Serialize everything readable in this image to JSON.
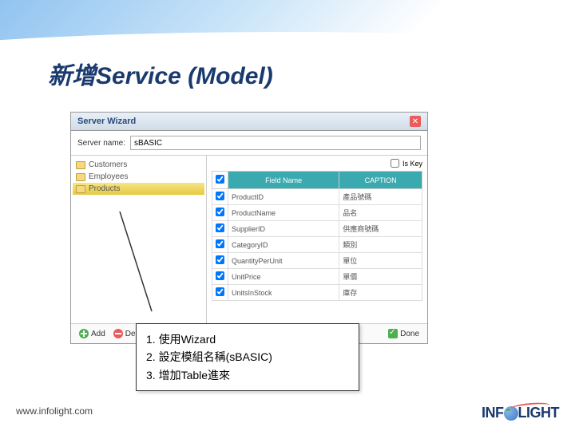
{
  "slide": {
    "title": "新增Service (Model)"
  },
  "wizard": {
    "title": "Server Wizard",
    "serverNameLabel": "Server name:",
    "serverNameValue": "sBASIC",
    "tree": {
      "items": [
        {
          "label": "Customers",
          "selected": false
        },
        {
          "label": "Employees",
          "selected": false
        },
        {
          "label": "Products",
          "selected": true
        }
      ]
    },
    "isKeyLabel": "Is Key",
    "columns": {
      "check": "✓",
      "fieldName": "Field Name",
      "caption": "CAPTION"
    },
    "rows": [
      {
        "checked": true,
        "field": "ProductID",
        "caption": "產品號碼"
      },
      {
        "checked": true,
        "field": "ProductName",
        "caption": "品名"
      },
      {
        "checked": true,
        "field": "SupplierID",
        "caption": "供應商號碼"
      },
      {
        "checked": true,
        "field": "CategoryID",
        "caption": "類別"
      },
      {
        "checked": true,
        "field": "QuantityPerUnit",
        "caption": "單位"
      },
      {
        "checked": true,
        "field": "UnitPrice",
        "caption": "單價"
      },
      {
        "checked": true,
        "field": "UnitsInStock",
        "caption": "庫存"
      }
    ],
    "buttons": {
      "add": "Add",
      "del": "Del",
      "done": "Done"
    }
  },
  "callout": {
    "items": [
      "使用Wizard",
      "設定模組名稱(sBASIC)",
      "增加Table進來"
    ]
  },
  "footer": {
    "url": "www.infolight.com",
    "brand": "INFOLIGHT"
  }
}
